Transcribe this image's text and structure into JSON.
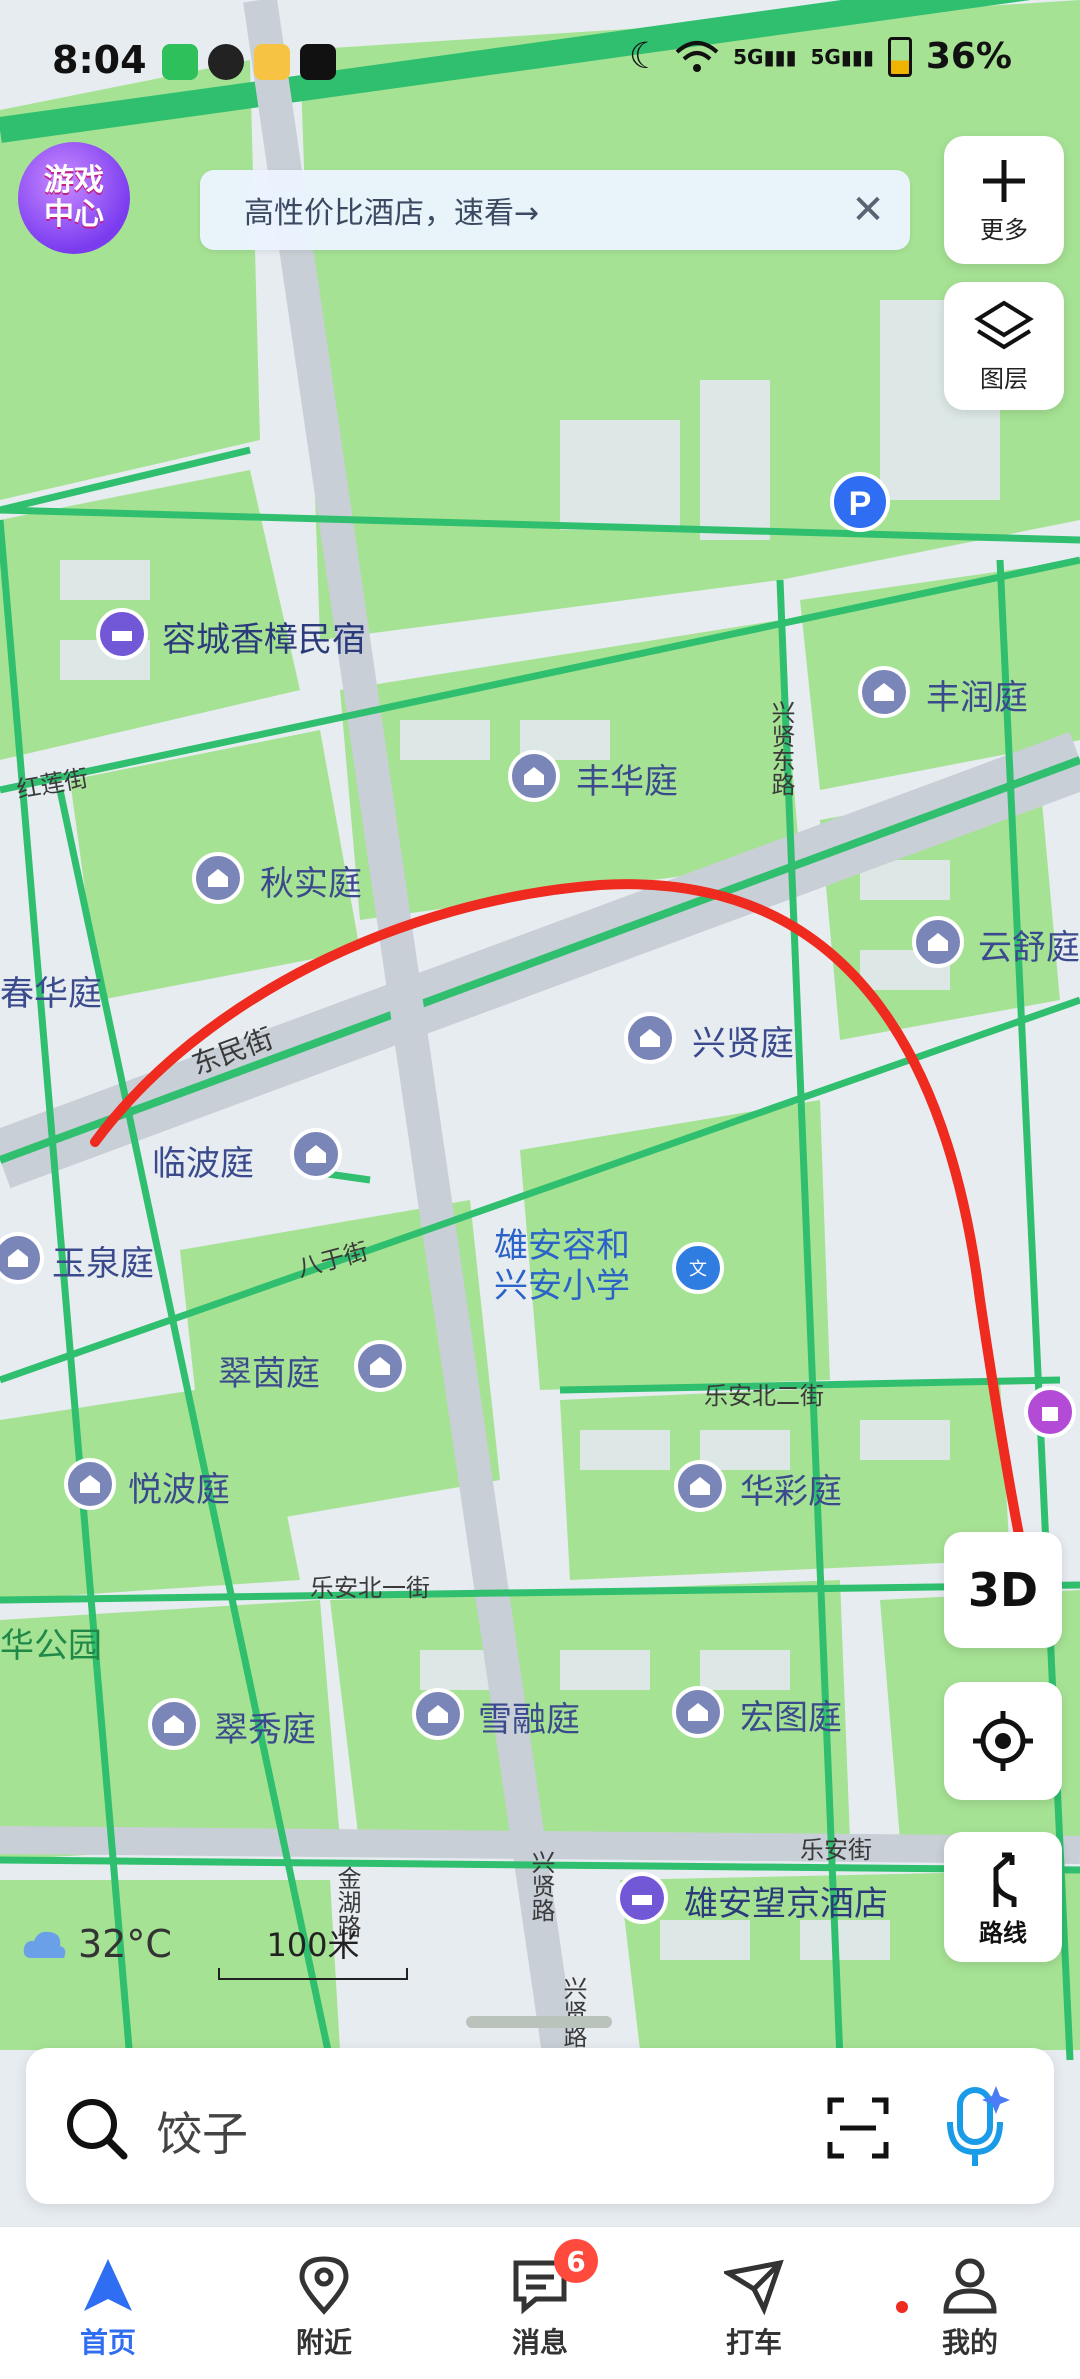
{
  "status_bar": {
    "time": "8:04",
    "network": "5G",
    "battery": "36%"
  },
  "game_center": {
    "label_line1": "游戏",
    "label_line2": "中心"
  },
  "banner": {
    "text": "高性价比酒店，速看→"
  },
  "side_buttons": {
    "more": "更多",
    "layers": "图层"
  },
  "map_controls": {
    "three_d": "3D",
    "route": "路线"
  },
  "map_labels": {
    "rongcheng_inn": "容城香樟民宿",
    "fengrun": "丰润庭",
    "fenghua": "丰华庭",
    "qiushi": "秋实庭",
    "yunshu": "云舒庭",
    "chunhua": "春华庭",
    "xingxian": "兴贤庭",
    "linbo": "临波庭",
    "yuquan": "玉泉庭",
    "school_line1": "雄安容和",
    "school_line2": "兴安小学",
    "cuiyin": "翠茵庭",
    "yuebo": "悦波庭",
    "huacai": "华彩庭",
    "park": "华公园",
    "cuixiu": "翠秀庭",
    "xuerong": "雪融庭",
    "hongtu": "宏图庭",
    "hotel": "雄安望京酒店"
  },
  "streets": {
    "honglian": "红莲街",
    "xingxian_east": "兴贤东路",
    "dongmin": "东民街",
    "bayu": "八于街",
    "lean_north2": "乐安北二街",
    "lean_north1": "乐安北一街",
    "lean": "乐安街",
    "jinhu": "金湖路",
    "xingxian_road": "兴贤路",
    "xingxian_road2": "兴贤路"
  },
  "weather": {
    "temp": "32°C"
  },
  "scale": {
    "label": "100米"
  },
  "search": {
    "placeholder": "饺子"
  },
  "tabs": [
    {
      "label": "首页"
    },
    {
      "label": "附近"
    },
    {
      "label": "消息",
      "badge": "6"
    },
    {
      "label": "打车"
    },
    {
      "label": "我的"
    }
  ],
  "colors": {
    "road": "#2fbf6e",
    "block": "#9fe08f",
    "route": "#ef2a1e",
    "active_tab": "#2f6ef2"
  }
}
